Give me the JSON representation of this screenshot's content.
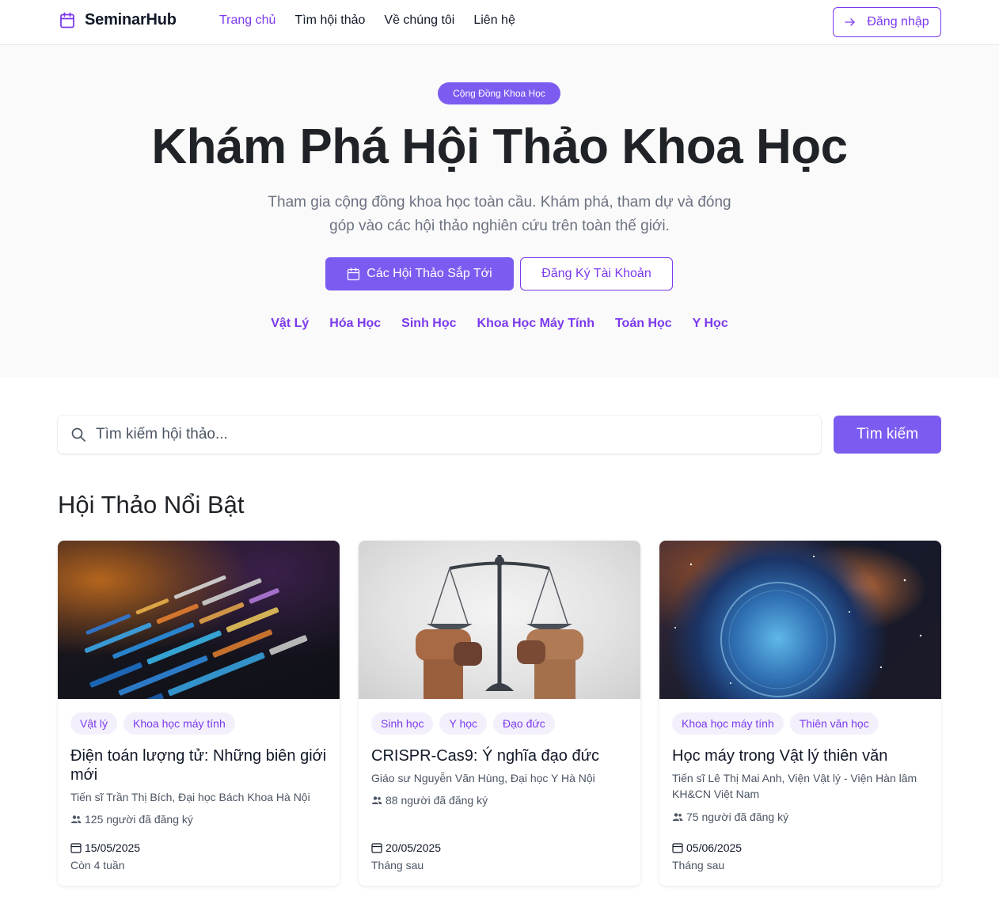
{
  "navbar": {
    "brand": "SeminarHub",
    "links": [
      "Trang chủ",
      "Tìm hội thảo",
      "Về chúng tôi",
      "Liên hệ"
    ],
    "login_label": "Đăng nhập"
  },
  "hero": {
    "badge": "Cộng Đồng Khoa Học",
    "title": "Khám Phá Hội Thảo Khoa Học",
    "subtitle": "Tham gia cộng đồng khoa học toàn cầu. Khám phá, tham dự và đóng góp vào các hội thảo nghiên cứu trên toàn thế giới.",
    "primary_label": "Các Hội Thảo Sắp Tới",
    "secondary_label": "Đăng Ký Tài Khoản",
    "topics": [
      "Vật Lý",
      "Hóa Học",
      "Sinh Học",
      "Khoa Học Máy Tính",
      "Toán Học",
      "Y Học"
    ]
  },
  "search": {
    "placeholder": "Tìm kiếm hội thảo...",
    "button_label": "Tìm kiếm"
  },
  "featured": {
    "title": "Hội Thảo Nổi Bật",
    "cards": [
      {
        "tags": [
          "Vật lý",
          "Khoa học máy tính"
        ],
        "title": "Điện toán lượng tử: Những biên giới mới",
        "author": "Tiến sĩ Trần Thị Bích, Đại học Bách Khoa Hà Nội",
        "registered": "125 người đã đăng ký",
        "date": "15/05/2025",
        "relative": "Còn 4 tuần"
      },
      {
        "tags": [
          "Sinh học",
          "Y học",
          "Đạo đức"
        ],
        "title": "CRISPR-Cas9: Ý nghĩa đạo đức",
        "author": "Giáo sư Nguyễn Văn Hùng, Đại học Y Hà Nội",
        "registered": "88 người đã đăng ký",
        "date": "20/05/2025",
        "relative": "Tháng sau"
      },
      {
        "tags": [
          "Khoa học máy tính",
          "Thiên văn học"
        ],
        "title": "Học máy trong Vật lý thiên văn",
        "author": "Tiến sĩ Lê Thị Mai Anh, Viện Vật lý - Viện Hàn lâm KH&CN Việt Nam",
        "registered": "75 người đã đăng ký",
        "date": "05/06/2025",
        "relative": "Tháng sau"
      }
    ]
  },
  "colors": {
    "accent": "#7c3aed",
    "accent_fill": "#7c5cf0",
    "hero_bg": "#fafafa"
  },
  "icons": [
    "calendar-icon",
    "arrow-right-icon",
    "search-icon",
    "users-icon"
  ]
}
